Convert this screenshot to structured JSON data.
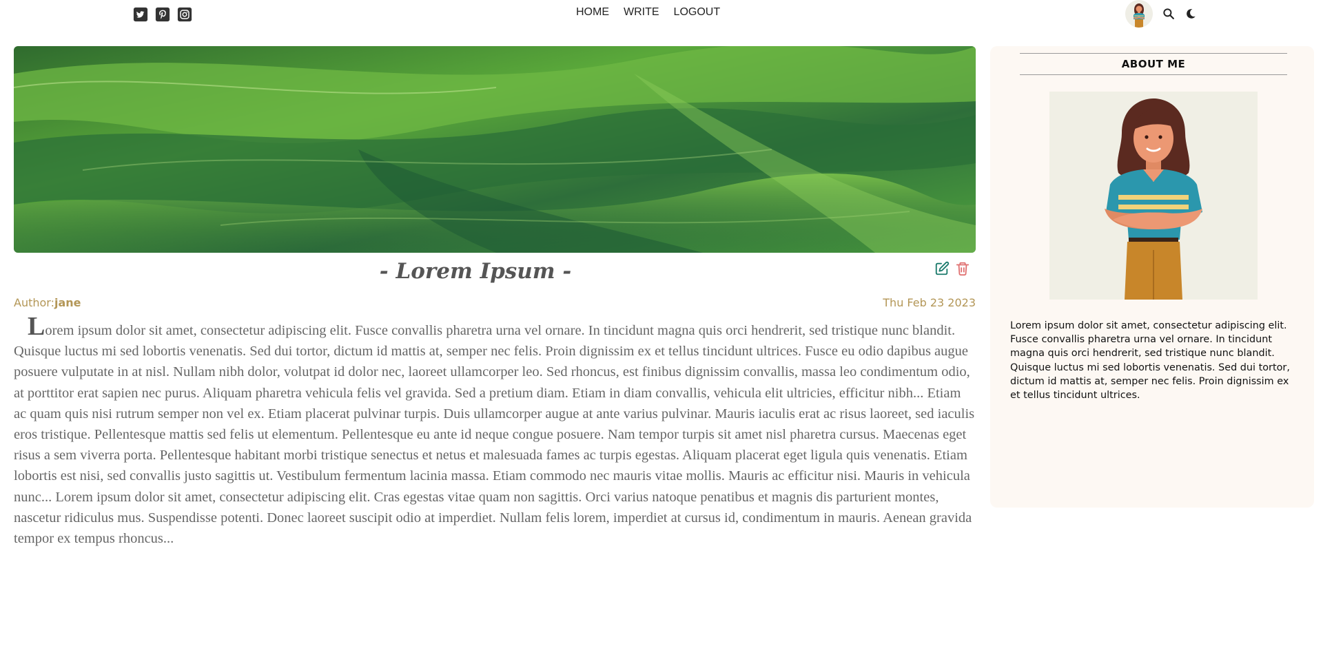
{
  "nav": {
    "social_icons": [
      "twitter-icon",
      "pinterest-icon",
      "instagram-icon"
    ],
    "menu": [
      {
        "label": "HOME"
      },
      {
        "label": "WRITE"
      },
      {
        "label": "LOGOUT"
      }
    ],
    "tools": [
      "avatar",
      "search-icon",
      "moon-icon"
    ]
  },
  "post": {
    "title": "- Lorem Ipsum -",
    "author_label": "Author:",
    "author_name": "jane",
    "date": "Thu Feb 23 2023",
    "body_first_letter": "L",
    "body_rest": "orem ipsum dolor sit amet, consectetur adipiscing elit. Fusce convallis pharetra urna vel ornare. In tincidunt magna quis orci hendrerit, sed tristique nunc blandit. Quisque luctus mi sed lobortis venenatis. Sed dui tortor, dictum id mattis at, semper nec felis. Proin dignissim ex et tellus tincidunt ultrices. Fusce eu odio dapibus augue posuere vulputate in at nisl. Nullam nibh dolor, volutpat id dolor nec, laoreet ullamcorper leo. Sed rhoncus, est finibus dignissim convallis, massa leo condimentum odio, at porttitor erat sapien nec purus. Aliquam pharetra vehicula felis vel gravida. Sed a pretium diam. Etiam in diam convallis, vehicula elit ultricies, efficitur nibh... Etiam ac quam quis nisi rutrum semper non vel ex. Etiam placerat pulvinar turpis. Duis ullamcorper augue at ante varius pulvinar. Mauris iaculis erat ac risus laoreet, sed iaculis eros tristique. Pellentesque mattis sed felis ut elementum. Pellentesque eu ante id neque congue posuere. Nam tempor turpis sit amet nisl pharetra cursus. Maecenas eget risus a sem viverra porta. Pellentesque habitant morbi tristique senectus et netus et malesuada fames ac turpis egestas. Aliquam placerat eget ligula quis venenatis. Etiam lobortis est nisi, sed convallis justo sagittis ut. Vestibulum fermentum lacinia massa. Etiam commodo nec mauris vitae mollis. Mauris ac efficitur nisi. Mauris in vehicula nunc... Lorem ipsum dolor sit amet, consectetur adipiscing elit. Cras egestas vitae quam non sagittis. Orci varius natoque penatibus et magnis dis parturient montes, nascetur ridiculus mus. Suspendisse potenti. Donec laoreet suscipit odio at imperdiet. Nullam felis lorem, imperdiet at cursus id, condimentum in mauris. Aenean gravida tempor ex tempus rhoncus..."
  },
  "sidebar": {
    "title": "ABOUT ME",
    "text": "Lorem ipsum dolor sit amet, consectetur adipiscing elit. Fusce convallis pharetra urna vel ornare. In tincidunt magna quis orci hendrerit, sed tristique nunc blandit. Quisque luctus mi sed lobortis venenatis. Sed dui tortor, dictum id mattis at, semper nec felis. Proin dignissim ex et tellus tincidunt ultrices."
  },
  "colors": {
    "meta": "#b39656",
    "edit": "#1a7a6b",
    "delete": "#e07070",
    "sidebar_bg": "#fdf8f3"
  }
}
